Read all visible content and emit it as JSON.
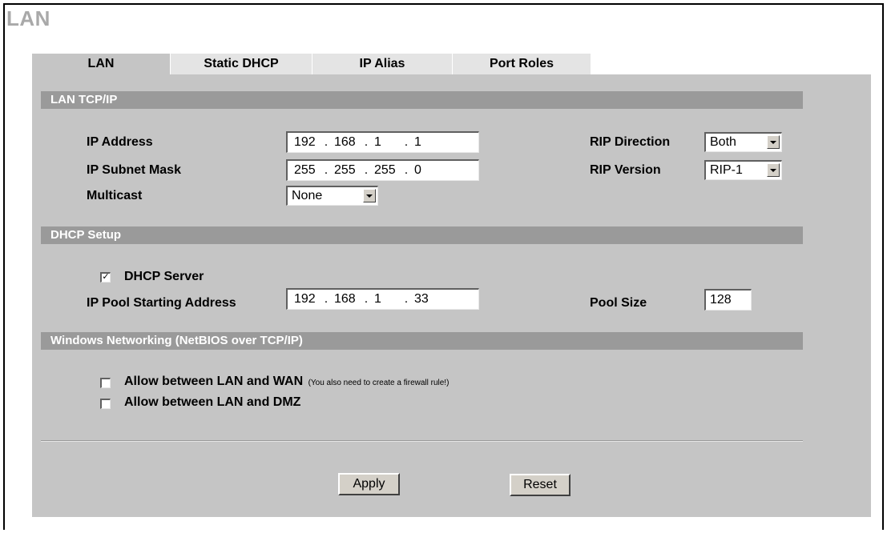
{
  "page": {
    "title": "LAN"
  },
  "tabs": [
    {
      "label": "LAN",
      "active": true
    },
    {
      "label": "Static DHCP",
      "active": false
    },
    {
      "label": "IP Alias",
      "active": false
    },
    {
      "label": "Port Roles",
      "active": false
    }
  ],
  "lan_tcpip": {
    "header": "LAN TCP/IP",
    "ip_address_label": "IP Address",
    "ip_address": [
      "192",
      "168",
      "1",
      "1"
    ],
    "subnet_label": "IP Subnet Mask",
    "subnet": [
      "255",
      "255",
      "255",
      "0"
    ],
    "multicast_label": "Multicast",
    "multicast_value": "None",
    "rip_direction_label": "RIP Direction",
    "rip_direction_value": "Both",
    "rip_version_label": "RIP Version",
    "rip_version_value": "RIP-1"
  },
  "dhcp": {
    "header": "DHCP Setup",
    "server_label": "DHCP Server",
    "server_checked": true,
    "pool_start_label": "IP Pool Starting Address",
    "pool_start": [
      "192",
      "168",
      "1",
      "33"
    ],
    "pool_size_label": "Pool Size",
    "pool_size": "128"
  },
  "netbios": {
    "header": "Windows Networking (NetBIOS over TCP/IP)",
    "lan_wan_label": "Allow between LAN and WAN",
    "lan_wan_note": "(You also need to create a firewall rule!)",
    "lan_wan_checked": false,
    "lan_dmz_label": "Allow between LAN and DMZ",
    "lan_dmz_checked": false
  },
  "buttons": {
    "apply": "Apply",
    "reset": "Reset"
  },
  "glyphs": {
    "ip_sep": ".",
    "check": "✓"
  }
}
